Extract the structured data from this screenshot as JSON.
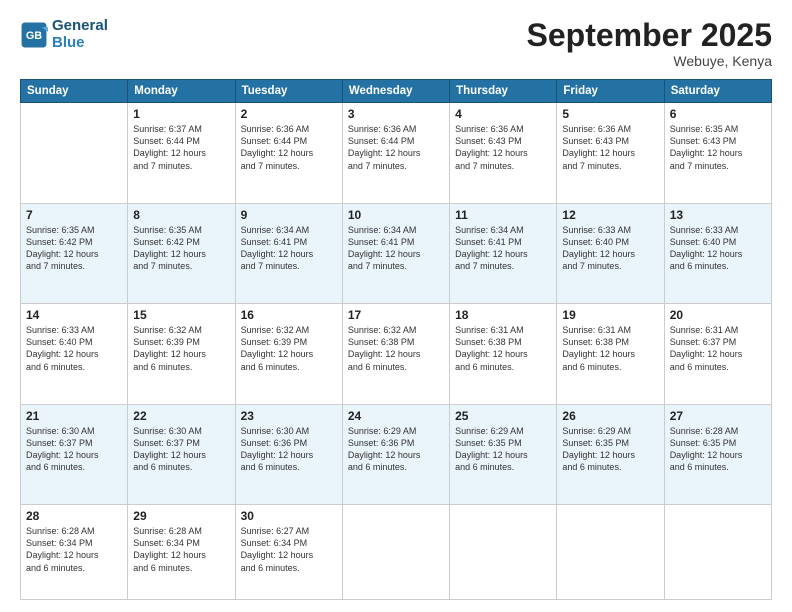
{
  "header": {
    "logo_line1": "General",
    "logo_line2": "Blue",
    "month": "September 2025",
    "location": "Webuye, Kenya"
  },
  "days_of_week": [
    "Sunday",
    "Monday",
    "Tuesday",
    "Wednesday",
    "Thursday",
    "Friday",
    "Saturday"
  ],
  "weeks": [
    [
      {
        "day": "",
        "text": ""
      },
      {
        "day": "1",
        "text": "Sunrise: 6:37 AM\nSunset: 6:44 PM\nDaylight: 12 hours\nand 7 minutes."
      },
      {
        "day": "2",
        "text": "Sunrise: 6:36 AM\nSunset: 6:44 PM\nDaylight: 12 hours\nand 7 minutes."
      },
      {
        "day": "3",
        "text": "Sunrise: 6:36 AM\nSunset: 6:44 PM\nDaylight: 12 hours\nand 7 minutes."
      },
      {
        "day": "4",
        "text": "Sunrise: 6:36 AM\nSunset: 6:43 PM\nDaylight: 12 hours\nand 7 minutes."
      },
      {
        "day": "5",
        "text": "Sunrise: 6:36 AM\nSunset: 6:43 PM\nDaylight: 12 hours\nand 7 minutes."
      },
      {
        "day": "6",
        "text": "Sunrise: 6:35 AM\nSunset: 6:43 PM\nDaylight: 12 hours\nand 7 minutes."
      }
    ],
    [
      {
        "day": "7",
        "text": "Sunrise: 6:35 AM\nSunset: 6:42 PM\nDaylight: 12 hours\nand 7 minutes."
      },
      {
        "day": "8",
        "text": "Sunrise: 6:35 AM\nSunset: 6:42 PM\nDaylight: 12 hours\nand 7 minutes."
      },
      {
        "day": "9",
        "text": "Sunrise: 6:34 AM\nSunset: 6:41 PM\nDaylight: 12 hours\nand 7 minutes."
      },
      {
        "day": "10",
        "text": "Sunrise: 6:34 AM\nSunset: 6:41 PM\nDaylight: 12 hours\nand 7 minutes."
      },
      {
        "day": "11",
        "text": "Sunrise: 6:34 AM\nSunset: 6:41 PM\nDaylight: 12 hours\nand 7 minutes."
      },
      {
        "day": "12",
        "text": "Sunrise: 6:33 AM\nSunset: 6:40 PM\nDaylight: 12 hours\nand 7 minutes."
      },
      {
        "day": "13",
        "text": "Sunrise: 6:33 AM\nSunset: 6:40 PM\nDaylight: 12 hours\nand 6 minutes."
      }
    ],
    [
      {
        "day": "14",
        "text": "Sunrise: 6:33 AM\nSunset: 6:40 PM\nDaylight: 12 hours\nand 6 minutes."
      },
      {
        "day": "15",
        "text": "Sunrise: 6:32 AM\nSunset: 6:39 PM\nDaylight: 12 hours\nand 6 minutes."
      },
      {
        "day": "16",
        "text": "Sunrise: 6:32 AM\nSunset: 6:39 PM\nDaylight: 12 hours\nand 6 minutes."
      },
      {
        "day": "17",
        "text": "Sunrise: 6:32 AM\nSunset: 6:38 PM\nDaylight: 12 hours\nand 6 minutes."
      },
      {
        "day": "18",
        "text": "Sunrise: 6:31 AM\nSunset: 6:38 PM\nDaylight: 12 hours\nand 6 minutes."
      },
      {
        "day": "19",
        "text": "Sunrise: 6:31 AM\nSunset: 6:38 PM\nDaylight: 12 hours\nand 6 minutes."
      },
      {
        "day": "20",
        "text": "Sunrise: 6:31 AM\nSunset: 6:37 PM\nDaylight: 12 hours\nand 6 minutes."
      }
    ],
    [
      {
        "day": "21",
        "text": "Sunrise: 6:30 AM\nSunset: 6:37 PM\nDaylight: 12 hours\nand 6 minutes."
      },
      {
        "day": "22",
        "text": "Sunrise: 6:30 AM\nSunset: 6:37 PM\nDaylight: 12 hours\nand 6 minutes."
      },
      {
        "day": "23",
        "text": "Sunrise: 6:30 AM\nSunset: 6:36 PM\nDaylight: 12 hours\nand 6 minutes."
      },
      {
        "day": "24",
        "text": "Sunrise: 6:29 AM\nSunset: 6:36 PM\nDaylight: 12 hours\nand 6 minutes."
      },
      {
        "day": "25",
        "text": "Sunrise: 6:29 AM\nSunset: 6:35 PM\nDaylight: 12 hours\nand 6 minutes."
      },
      {
        "day": "26",
        "text": "Sunrise: 6:29 AM\nSunset: 6:35 PM\nDaylight: 12 hours\nand 6 minutes."
      },
      {
        "day": "27",
        "text": "Sunrise: 6:28 AM\nSunset: 6:35 PM\nDaylight: 12 hours\nand 6 minutes."
      }
    ],
    [
      {
        "day": "28",
        "text": "Sunrise: 6:28 AM\nSunset: 6:34 PM\nDaylight: 12 hours\nand 6 minutes."
      },
      {
        "day": "29",
        "text": "Sunrise: 6:28 AM\nSunset: 6:34 PM\nDaylight: 12 hours\nand 6 minutes."
      },
      {
        "day": "30",
        "text": "Sunrise: 6:27 AM\nSunset: 6:34 PM\nDaylight: 12 hours\nand 6 minutes."
      },
      {
        "day": "",
        "text": ""
      },
      {
        "day": "",
        "text": ""
      },
      {
        "day": "",
        "text": ""
      },
      {
        "day": "",
        "text": ""
      }
    ]
  ]
}
